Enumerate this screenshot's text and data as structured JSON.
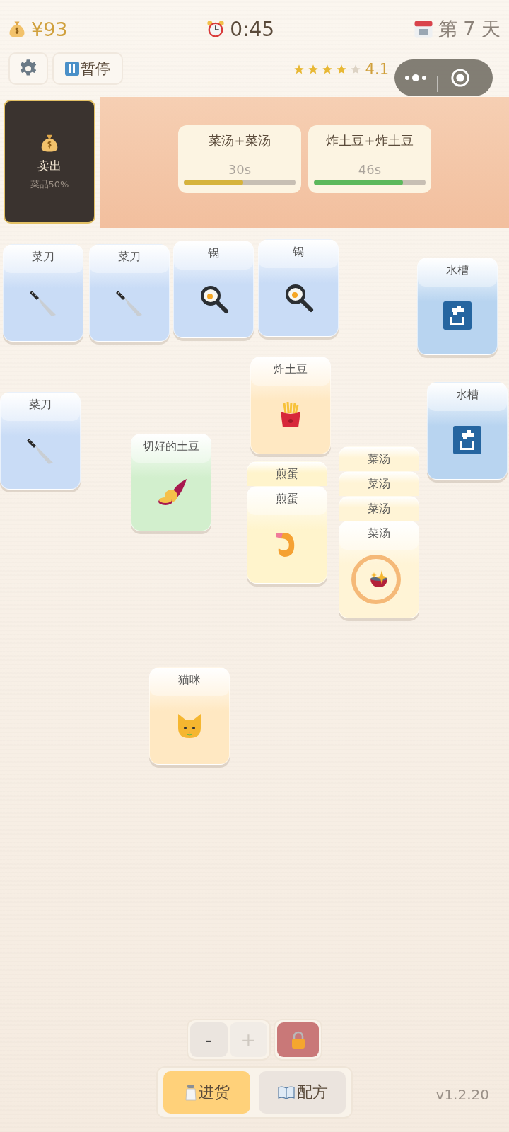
{
  "status": {
    "money": "¥93",
    "timer": "0:45",
    "day": "第 7 天"
  },
  "pause_label": "暂停",
  "rating": {
    "stars": 4,
    "text": "4.1"
  },
  "sell": {
    "label": "卖出",
    "note": "菜品50%"
  },
  "orders": [
    {
      "name": "菜汤+菜汤",
      "time": "30s",
      "level": 0.53,
      "color": "#d6b33c"
    },
    {
      "name": "炸土豆+炸土豆",
      "time": "46s",
      "level": 0.8,
      "color": "#5cb85c"
    }
  ],
  "stacks": [
    {
      "cards": [
        {
          "title": "菜刀",
          "color": "#c9dcf6",
          "kind": "knife",
          "highlighted": false
        }
      ]
    },
    {
      "cards": [
        {
          "title": "菜刀",
          "color": "#c9dcf6",
          "kind": "knife",
          "highlighted": false
        }
      ]
    },
    {
      "cards": [
        {
          "title": "锅",
          "color": "#c9dcf6",
          "kind": "pan",
          "highlighted": false
        }
      ]
    },
    {
      "cards": [
        {
          "title": "锅",
          "color": "#c9dcf6",
          "kind": "pan",
          "highlighted": false
        }
      ]
    },
    {
      "cards": [
        {
          "title": "水槽",
          "color": "#b8d4f0",
          "kind": "faucet",
          "highlighted": false
        }
      ]
    },
    {
      "cards": [
        {
          "title": "炸土豆",
          "color": "#ffe8c2",
          "kind": "fries",
          "highlighted": false
        }
      ]
    },
    {
      "cards": [
        {
          "title": "菜刀",
          "color": "#c9dcf6",
          "kind": "knife",
          "highlighted": false
        }
      ]
    },
    {
      "cards": [
        {
          "title": "水槽",
          "color": "#b8d4f0",
          "kind": "faucet",
          "highlighted": false
        }
      ]
    },
    {
      "cards": [
        {
          "title": "切好的土豆",
          "color": "#d2efcd",
          "kind": "potato",
          "highlighted": false
        }
      ]
    },
    {
      "cards": [
        {
          "title": "煎蛋",
          "color": "#fff4cc"
        },
        {
          "title": "煎蛋",
          "color": "#fff4cc",
          "kind": "shrimp",
          "highlighted": false
        }
      ]
    },
    {
      "cards": [
        {
          "title": "菜汤",
          "color": "#fff4d6"
        },
        {
          "title": "菜汤",
          "color": "#fff4d6"
        },
        {
          "title": "菜汤",
          "color": "#fff4d6"
        },
        {
          "title": "菜汤",
          "color": "#fff4d6",
          "kind": "soup",
          "highlighted": true
        }
      ]
    },
    {
      "cards": [
        {
          "title": "猫咪",
          "color": "#ffe8c2",
          "kind": "cat",
          "highlighted": false
        }
      ]
    }
  ],
  "zoom": [
    {
      "label": "-",
      "disabled": false
    },
    {
      "label": "+",
      "disabled": true
    }
  ],
  "tabs": [
    {
      "label": "进货",
      "kind": "salt",
      "selected": true
    },
    {
      "label": "配方",
      "kind": "book",
      "selected": false
    }
  ],
  "version": "v1.2.20"
}
